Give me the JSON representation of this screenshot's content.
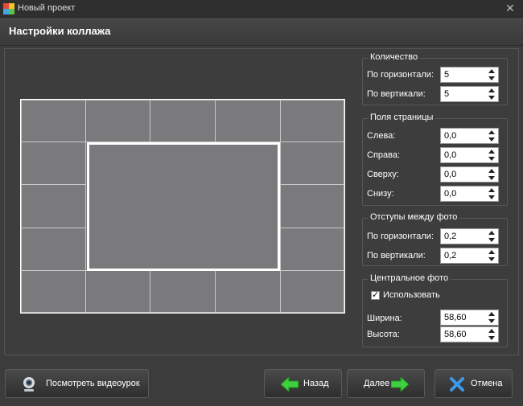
{
  "window": {
    "title": "Новый проект"
  },
  "header": {
    "title": "Настройки коллажа"
  },
  "groups": {
    "count": {
      "title": "Количество",
      "horizontal_label": "По горизонтали:",
      "horizontal_value": "5",
      "vertical_label": "По вертикали:",
      "vertical_value": "5"
    },
    "margins": {
      "title": "Поля страницы",
      "left_label": "Слева:",
      "left_value": "0,0",
      "right_label": "Справа:",
      "right_value": "0,0",
      "top_label": "Сверху:",
      "top_value": "0,0",
      "bottom_label": "Снизу:",
      "bottom_value": "0,0"
    },
    "spacing": {
      "title": "Отступы между фото",
      "horizontal_label": "По горизонтали:",
      "horizontal_value": "0,2",
      "vertical_label": "По вертикали:",
      "vertical_value": "0,2"
    },
    "central": {
      "title": "Центральное фото",
      "use_label": "Использовать",
      "use_checked": true,
      "width_label": "Ширина:",
      "width_value": "58,60",
      "height_label": "Высота:",
      "height_value": "58,60"
    }
  },
  "buttons": {
    "tutorial": "Посмотреть видеоурок",
    "back": "Назад",
    "next": "Далее",
    "cancel": "Отмена"
  },
  "colors": {
    "background": "#3c3c3c",
    "cell": "#7a797b",
    "arrow_green": "#3fcf3f",
    "cancel_blue": "#3a9ae8"
  }
}
